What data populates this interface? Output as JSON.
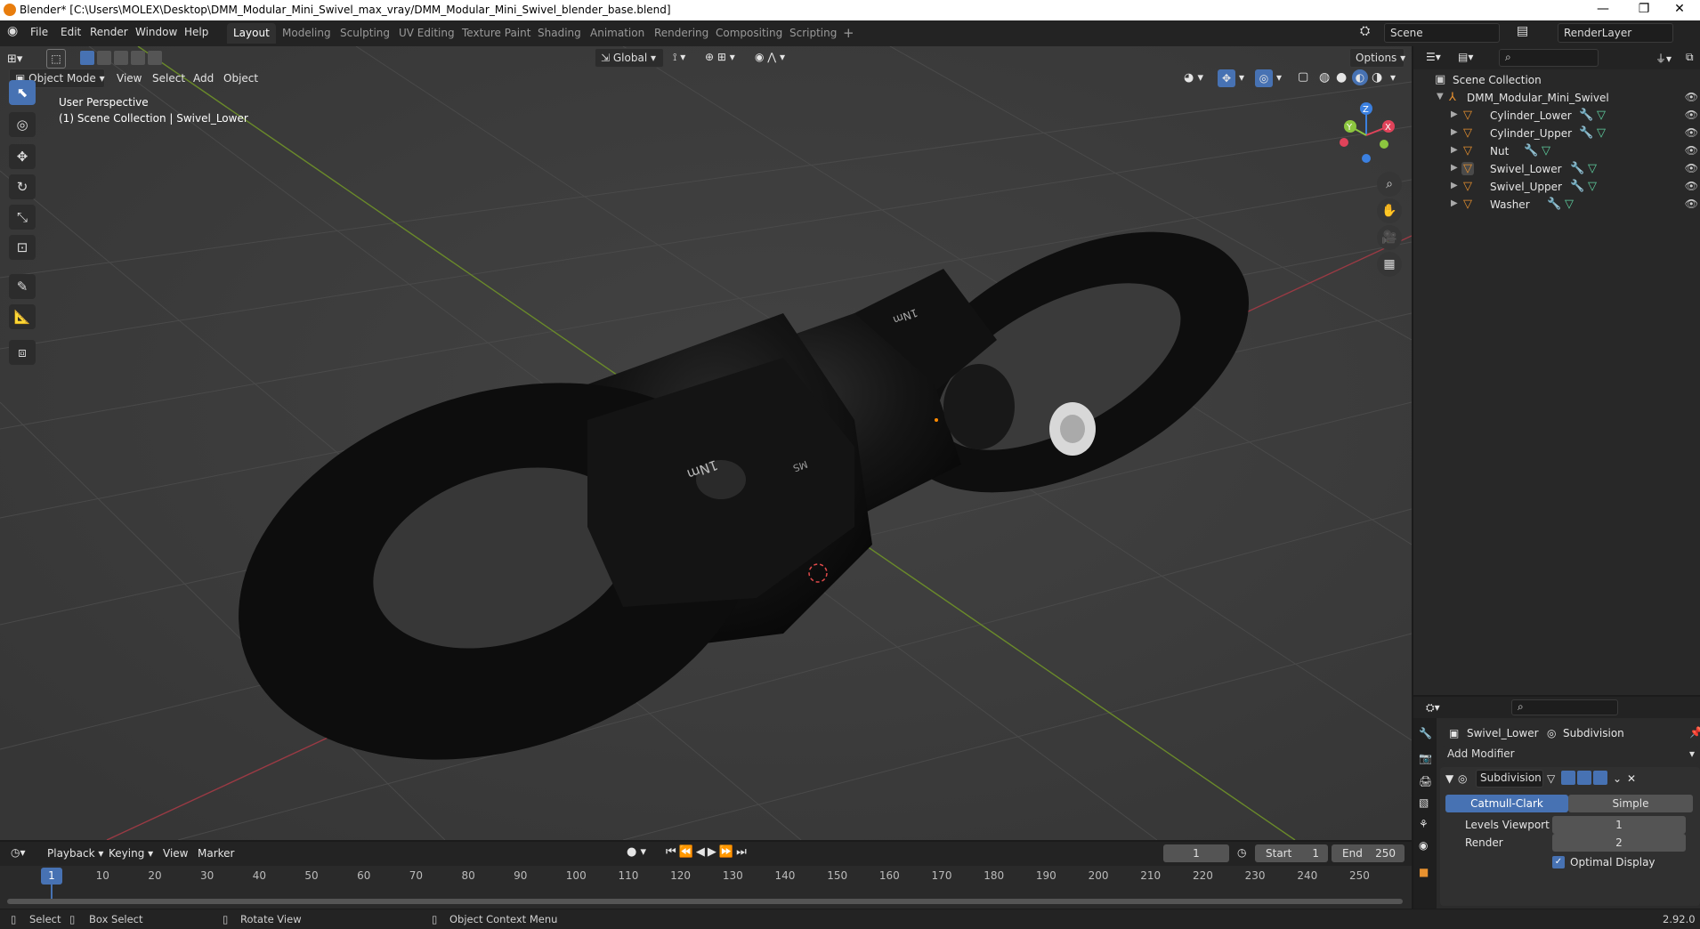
{
  "window": {
    "title": "Blender* [C:\\Users\\MOLEX\\Desktop\\DMM_Modular_Mini_Swivel_max_vray/DMM_Modular_Mini_Swivel_blender_base.blend]",
    "controls": [
      "—",
      "❐",
      "✕"
    ]
  },
  "menubar": {
    "items": [
      "File",
      "Edit",
      "Render",
      "Window",
      "Help"
    ],
    "workspaces": [
      "Layout",
      "Modeling",
      "Sculpting",
      "UV Editing",
      "Texture Paint",
      "Shading",
      "Animation",
      "Rendering",
      "Compositing",
      "Scripting"
    ],
    "active_workspace": "Layout",
    "add_workspace": "+",
    "scene": "Scene",
    "render_layer": "RenderLayer"
  },
  "viewport": {
    "orientation": "Global",
    "options_label": "Options",
    "mode": "Object Mode",
    "menus": [
      "View",
      "Select",
      "Add",
      "Object"
    ],
    "overlay_line1": "User Perspective",
    "overlay_line2": "(1) Scene Collection | Swivel_Lower",
    "gizmo_x": "X",
    "gizmo_y": "Y",
    "gizmo_z": "Z",
    "tools": [
      "select-box-tool",
      "cursor-tool",
      "move-tool",
      "rotate-tool",
      "scale-tool",
      "transform-tool",
      "annotate-tool",
      "measure-tool",
      "add-cube-tool"
    ]
  },
  "outliner": {
    "root": "Scene Collection",
    "collection": "DMM_Modular_Mini_Swivel",
    "objects": [
      {
        "name": "Cylinder_Lower"
      },
      {
        "name": "Cylinder_Upper"
      },
      {
        "name": "Nut"
      },
      {
        "name": "Swivel_Lower"
      },
      {
        "name": "Swivel_Upper"
      },
      {
        "name": "Washer"
      }
    ],
    "active_object": "Swivel_Lower"
  },
  "properties": {
    "object_name": "Swivel_Lower",
    "modifier_name_crumb": "Subdivision",
    "add_modifier": "Add Modifier",
    "modifier_field": "Subdivision",
    "algorithm_options": [
      "Catmull-Clark",
      "Simple"
    ],
    "algorithm_selected": "Catmull-Clark",
    "levels_viewport_label": "Levels Viewport",
    "levels_viewport_value": "1",
    "render_label": "Render",
    "render_value": "2",
    "optimal_display_label": "Optimal Display",
    "optimal_display_checked": true
  },
  "timeline": {
    "menus": [
      "Playback",
      "Keying",
      "View",
      "Marker"
    ],
    "current_frame": "1",
    "start_label": "Start",
    "start_value": "1",
    "end_label": "End",
    "end_value": "250",
    "ticks": [
      "1",
      "10",
      "20",
      "30",
      "40",
      "50",
      "60",
      "70",
      "80",
      "90",
      "100",
      "110",
      "120",
      "130",
      "140",
      "150",
      "160",
      "170",
      "180",
      "190",
      "200",
      "210",
      "220",
      "230",
      "240",
      "250"
    ]
  },
  "statusbar": {
    "select": "Select",
    "box_select": "Box Select",
    "rotate_view": "Rotate View",
    "context_menu": "Object Context Menu",
    "version": "2.92.0"
  },
  "colors": {
    "accent": "#4772b3",
    "axis_x": "#e0435a",
    "axis_y": "#8cc63f",
    "axis_z": "#3b80e0",
    "object_orange": "#e8912f"
  }
}
